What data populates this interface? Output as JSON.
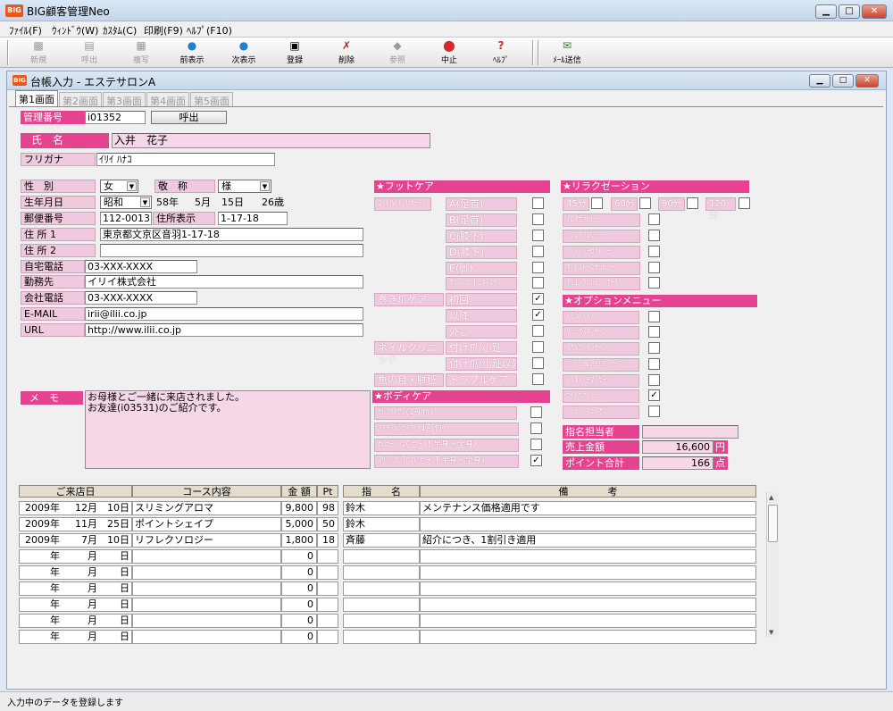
{
  "app": {
    "title": "BIG顧客管理Neo",
    "logo": "BIG"
  },
  "menu": [
    "ﾌｧｲﾙ(F)",
    "ｳｨﾝﾄﾞｳ(W)",
    "ｶｽﾀﾑ(C)",
    "印刷(F9)",
    "ﾍﾙﾌﾟ(F10)"
  ],
  "toolbar": [
    {
      "label": "新規",
      "icon": "new-icon",
      "enabled": false
    },
    {
      "label": "呼出",
      "icon": "folder-icon",
      "enabled": false
    },
    {
      "label": "複写",
      "icon": "copy-icon",
      "enabled": false
    },
    {
      "label": "前表示",
      "icon": "prev-icon",
      "enabled": true
    },
    {
      "label": "次表示",
      "icon": "next-icon",
      "enabled": true
    },
    {
      "label": "登録",
      "icon": "save-icon",
      "enabled": true
    },
    {
      "label": "削除",
      "icon": "delete-icon",
      "enabled": true
    },
    {
      "label": "参照",
      "icon": "reference-icon",
      "enabled": false
    },
    {
      "label": "中止",
      "icon": "stop-icon",
      "enabled": true
    },
    {
      "label": "ﾍﾙﾌﾟ",
      "icon": "help-icon",
      "enabled": true
    },
    {
      "label": "ﾒｰﾙ送信",
      "icon": "mail-icon",
      "enabled": true
    }
  ],
  "inner": {
    "title": "台帳入力 - エステサロンA",
    "logo": "BIG"
  },
  "tabs": [
    "第1画面",
    "第2画面",
    "第3画面",
    "第4画面",
    "第5画面"
  ],
  "form": {
    "kanri_label": "管理番号",
    "kanri_value": "i01352",
    "yobidashi": "呼出",
    "name_label": "氏　名",
    "name_value": "入井　花子",
    "furigana_label": "フリガナ",
    "furigana_value": "ｲﾘｲ ﾊﾅｺ",
    "seibetsu_label": "性　別",
    "seibetsu_value": "女",
    "keisho_label": "敬　称",
    "keisho_value": "様",
    "birth_label": "生年月日",
    "birth_era": "昭和",
    "birth_year": "58年",
    "birth_month": "5月",
    "birth_day": "15日",
    "age": "26歳",
    "zip_label": "郵便番号",
    "zip_value": "112-0013",
    "jusho_hyoji_label": "住所表示",
    "jusho_hyoji_value": "1-17-18",
    "addr1_label": "住 所 1",
    "addr1_value": "東京都文京区音羽1-17-18",
    "addr2_label": "住 所 2",
    "addr2_value": "",
    "home_tel_label": "自宅電話",
    "home_tel_value": "03-XXX-XXXX",
    "work_label": "勤務先",
    "work_value": "イリイ株式会社",
    "work_tel_label": "会社電話",
    "work_tel_value": "03-XXX-XXXX",
    "email_label": "E-MAIL",
    "email_value": "irii@ilii.co.jp",
    "url_label": "URL",
    "url_value": "http://www.ilii.co.jp",
    "memo_label": "メ　モ",
    "memo_value": "お母様とご一緒に来店されました。\nお友達(i03531)のご紹介です。"
  },
  "footcare": {
    "title": "★フットケア",
    "group1": "ﾌｯﾄﾊﾞﾄﾞﾚﾅｰｼﾞｭ",
    "items1": [
      {
        "label": "A(足首)",
        "checked": false
      },
      {
        "label": "B(足首)",
        "checked": false
      },
      {
        "label": "C(膝下)",
        "checked": false
      },
      {
        "label": "D(膝下)",
        "checked": false
      },
      {
        "label": "E(脚)",
        "checked": false
      },
      {
        "label": "ｵﾌﾟｼｮﾝﾄﾗﾌﾞﾙｹｱ",
        "checked": false
      }
    ],
    "group2": "巻き爪ケア",
    "items2": [
      {
        "label": "初回",
        "checked": true
      },
      {
        "label": "以降",
        "checked": true
      },
      {
        "label": "外し",
        "checked": false
      }
    ],
    "group3": "ネイルクリニック",
    "items3": [
      {
        "label": "付け爪/小趾",
        "checked": false
      },
      {
        "label": "付け爪/小趾以外",
        "checked": false
      }
    ],
    "group4": "魚の目・胼胝",
    "items4": [
      {
        "label": "トラブルケア",
        "checked": false
      }
    ]
  },
  "bodycare": {
    "title": "★ボディケア",
    "items": [
      {
        "label": "ｾﾙﾗｲﾄｹｱ(1部位)",
        "checked": false
      },
      {
        "label": "ﾎﾟｲﾝﾄｼｪｲﾌﾟ(1部位)",
        "checked": false
      },
      {
        "label": "ｾﾙﾅｰｼﾞｭ(上・下半身・全身)",
        "checked": false
      },
      {
        "label": "ｽﾘﾐﾝｸﾞｱﾛﾏ(上・下半身・全身)",
        "checked": true
      }
    ]
  },
  "relax": {
    "title": "★リラクゼーション",
    "times": [
      {
        "label": "45分",
        "checked": false
      },
      {
        "label": "60分",
        "checked": false
      },
      {
        "label": "90分",
        "checked": false
      },
      {
        "label": "120分",
        "checked": false
      }
    ],
    "items": [
      {
        "label": "ｱﾛﾏｾﾗﾋﾟｰ",
        "checked": false
      },
      {
        "label": "ﾘﾌﾚｸｿﾛｼﾞｰ",
        "checked": false
      },
      {
        "label": "ﾍｯﾄﾞｼｰｾﾗﾋﾟｰ",
        "checked": false
      },
      {
        "label": "ﾎｯﾄｽﾄｰﾝｾﾗﾋﾟｰ",
        "checked": false
      },
      {
        "label": "ｵﾘｴﾝﾀﾙﾊｰﾌﾞﾎｰﾙ",
        "checked": false
      }
    ]
  },
  "option": {
    "title": "★オプションメニュー",
    "items": [
      {
        "label": "ﾄﾗﾌﾞﾙｹｱ",
        "checked": false
      },
      {
        "label": "ﾘﾗｯｸｽﾏｯｻｰｼﾞ",
        "checked": false
      },
      {
        "label": "ｽｶﾙﾌﾟﾏｯｻｰｼﾞ",
        "checked": false
      },
      {
        "label": "ﾊﾝﾄﾞ＆ｱｰﾑﾏｯｻｰｼﾞ",
        "checked": false
      },
      {
        "label": "ｼｮﾙﾀﾞｰﾏｯｻｰｼﾞ",
        "checked": false
      },
      {
        "label": "ﾗｲﾄｾﾗﾋﾟｰ",
        "checked": true
      },
      {
        "label": "ﾍﾟﾃﾞｨｷｭｱｵﾌ",
        "checked": false
      }
    ]
  },
  "summary": {
    "tanto_label": "指名担当者",
    "tanto_value": "",
    "sales_label": "売上金額",
    "sales_value": "16,600",
    "sales_unit": "円",
    "point_label": "ポイント合計",
    "point_value": "166",
    "point_unit": "点"
  },
  "grid": {
    "headers": [
      "ご来店日",
      "コース内容",
      "金 額",
      "Pt",
      "指　　名",
      "備　　　　考"
    ],
    "rows": [
      {
        "year": "2009年",
        "month": "12月",
        "day": "10日",
        "course": "スリミングアロマ",
        "amount": "9,800",
        "pt": "98",
        "staff": "鈴木",
        "note": "メンテナンス価格適用です"
      },
      {
        "year": "2009年",
        "month": "11月",
        "day": "25日",
        "course": "ポイントシェイプ",
        "amount": "5,000",
        "pt": "50",
        "staff": "鈴木",
        "note": ""
      },
      {
        "year": "2009年",
        "month": "7月",
        "day": "10日",
        "course": "リフレクソロジー",
        "amount": "1,800",
        "pt": "18",
        "staff": "斉藤",
        "note": "紹介につき、1割引き適用"
      },
      {
        "year": "年",
        "month": "月",
        "day": "日",
        "course": "",
        "amount": "0",
        "pt": "",
        "staff": "",
        "note": ""
      },
      {
        "year": "年",
        "month": "月",
        "day": "日",
        "course": "",
        "amount": "0",
        "pt": "",
        "staff": "",
        "note": ""
      },
      {
        "year": "年",
        "month": "月",
        "day": "日",
        "course": "",
        "amount": "0",
        "pt": "",
        "staff": "",
        "note": ""
      },
      {
        "year": "年",
        "month": "月",
        "day": "日",
        "course": "",
        "amount": "0",
        "pt": "",
        "staff": "",
        "note": ""
      },
      {
        "year": "年",
        "month": "月",
        "day": "日",
        "course": "",
        "amount": "0",
        "pt": "",
        "staff": "",
        "note": ""
      },
      {
        "year": "年",
        "month": "月",
        "day": "日",
        "course": "",
        "amount": "0",
        "pt": "",
        "staff": "",
        "note": ""
      }
    ]
  },
  "status": "入力中のデータを登録します"
}
